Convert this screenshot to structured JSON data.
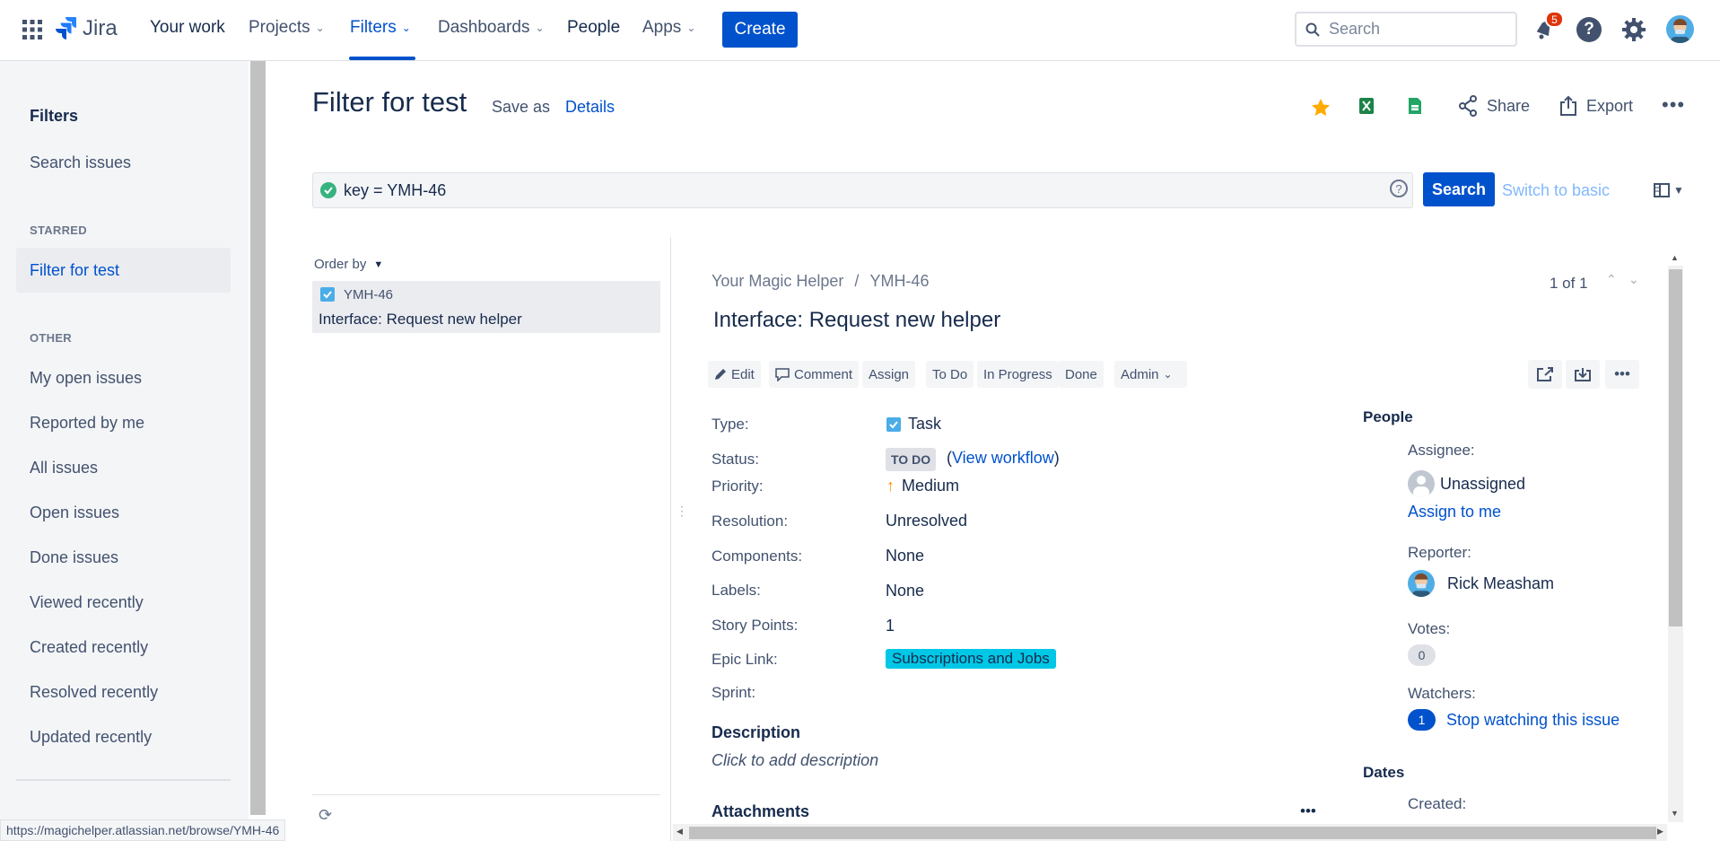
{
  "nav": {
    "brand": "Jira",
    "items": [
      "Your work",
      "Projects",
      "Filters",
      "Dashboards",
      "People",
      "Apps"
    ],
    "create_label": "Create",
    "search_placeholder": "Search",
    "notification_count": "5"
  },
  "sidebar": {
    "title": "Filters",
    "search_issues": "Search issues",
    "starred_header": "STARRED",
    "starred_items": [
      "Filter for test"
    ],
    "other_header": "OTHER",
    "other_items": [
      "My open issues",
      "Reported by me",
      "All issues",
      "Open issues",
      "Done issues",
      "Viewed recently",
      "Created recently",
      "Resolved recently",
      "Updated recently"
    ]
  },
  "header": {
    "title": "Filter for test",
    "save_as": "Save as",
    "details": "Details",
    "share": "Share",
    "export": "Export"
  },
  "jql": {
    "query": "key = YMH-46",
    "search_label": "Search",
    "switch_label": "Switch to basic"
  },
  "list": {
    "order_by": "Order by",
    "items": [
      {
        "key": "YMH-46",
        "summary": "Interface: Request new helper"
      }
    ]
  },
  "issue": {
    "project": "Your Magic Helper",
    "key": "YMH-46",
    "pager": "1 of 1",
    "summary": "Interface: Request new helper",
    "actions": {
      "edit": "Edit",
      "comment": "Comment",
      "assign": "Assign",
      "todo": "To Do",
      "inprogress": "In Progress",
      "done": "Done",
      "admin": "Admin"
    },
    "fields": {
      "type_label": "Type:",
      "type_value": "Task",
      "status_label": "Status:",
      "status_value": "TO DO",
      "view_workflow": "View workflow",
      "priority_label": "Priority:",
      "priority_value": "Medium",
      "resolution_label": "Resolution:",
      "resolution_value": "Unresolved",
      "components_label": "Components:",
      "components_value": "None",
      "labels_label": "Labels:",
      "labels_value": "None",
      "story_points_label": "Story Points:",
      "story_points_value": "1",
      "epic_link_label": "Epic Link:",
      "epic_link_value": "Subscriptions and Jobs",
      "sprint_label": "Sprint:"
    },
    "description_heading": "Description",
    "description_placeholder": "Click to add description",
    "attachments_heading": "Attachments",
    "people": {
      "heading": "People",
      "assignee_label": "Assignee:",
      "assignee_value": "Unassigned",
      "assign_to_me": "Assign to me",
      "reporter_label": "Reporter:",
      "reporter_value": "Rick Measham",
      "votes_label": "Votes:",
      "votes_value": "0",
      "watchers_label": "Watchers:",
      "watchers_value": "1",
      "stop_watching": "Stop watching this issue"
    },
    "dates": {
      "heading": "Dates",
      "created_label": "Created:"
    }
  },
  "status_url": "https://magichelper.atlassian.net/browse/YMH-46",
  "colors": {
    "brand": "#0052CC",
    "epic": "#00C7E6",
    "star": "#FFAB00",
    "badge": "#DE350B"
  }
}
